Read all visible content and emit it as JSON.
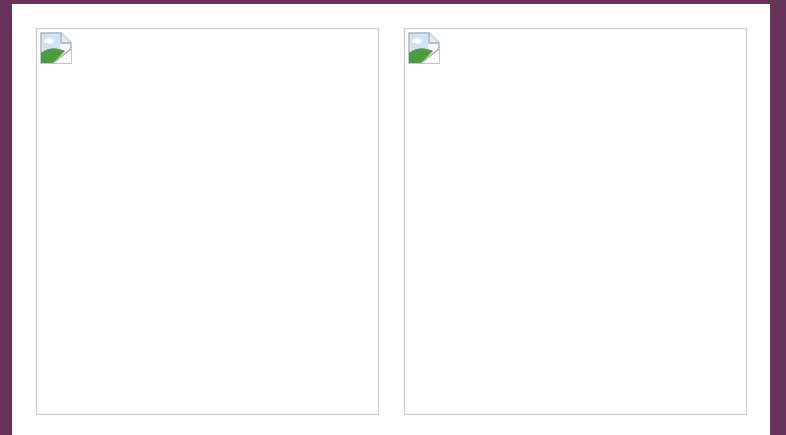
{
  "colors": {
    "background": "#663258",
    "panel": "#ffffff",
    "frame_border": "#c8c8c8"
  },
  "images": [
    {
      "icon": "broken-image-icon"
    },
    {
      "icon": "broken-image-icon"
    }
  ]
}
